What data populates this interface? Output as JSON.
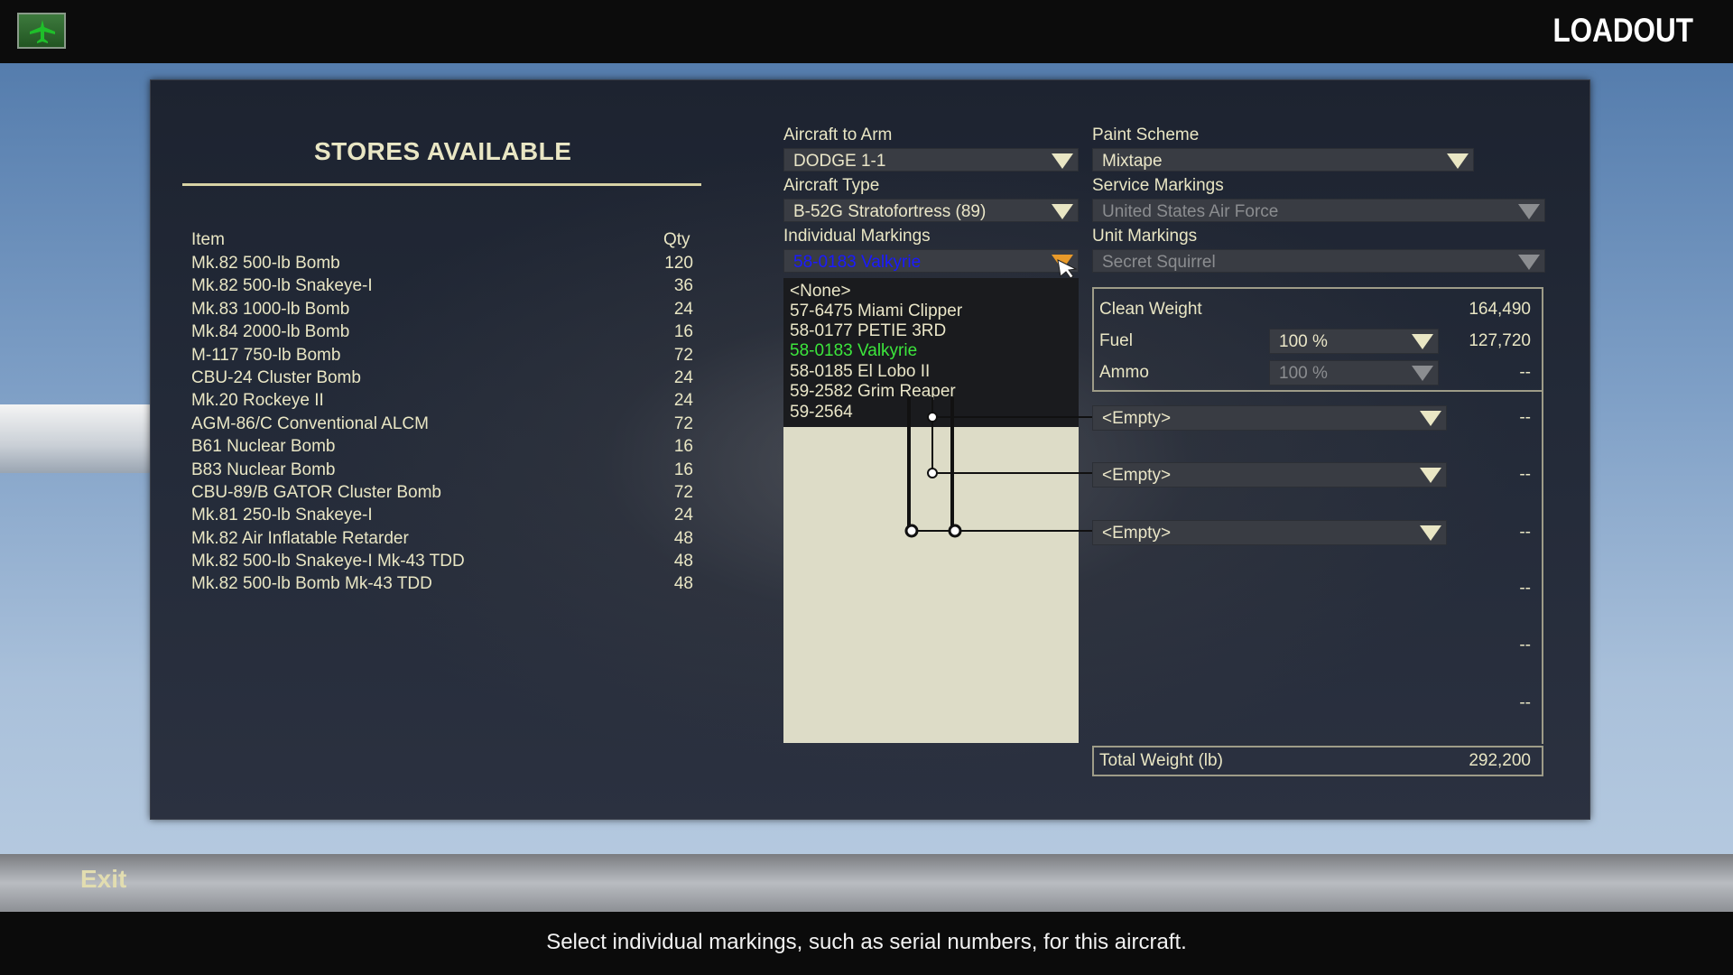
{
  "header": {
    "title": "LOADOUT"
  },
  "stores": {
    "title": "STORES AVAILABLE",
    "col_item": "Item",
    "col_qty": "Qty",
    "items": [
      {
        "name": "Mk.82 500-lb Bomb",
        "qty": "120"
      },
      {
        "name": "Mk.82 500-lb Snakeye-I",
        "qty": "36"
      },
      {
        "name": "Mk.83 1000-lb Bomb",
        "qty": "24"
      },
      {
        "name": "Mk.84 2000-lb Bomb",
        "qty": "16"
      },
      {
        "name": "M-117 750-lb Bomb",
        "qty": "72"
      },
      {
        "name": "CBU-24 Cluster Bomb",
        "qty": "24"
      },
      {
        "name": "Mk.20 Rockeye II",
        "qty": "24"
      },
      {
        "name": "AGM-86/C Conventional ALCM",
        "qty": "72"
      },
      {
        "name": "B61 Nuclear Bomb",
        "qty": "16"
      },
      {
        "name": "B83 Nuclear Bomb",
        "qty": "16"
      },
      {
        "name": "CBU-89/B GATOR Cluster Bomb",
        "qty": "72"
      },
      {
        "name": "Mk.81 250-lb Snakeye-I",
        "qty": "24"
      },
      {
        "name": "Mk.82 Air Inflatable Retarder",
        "qty": "48"
      },
      {
        "name": "Mk.82 500-lb Snakeye-I Mk-43 TDD",
        "qty": "48"
      },
      {
        "name": "Mk.82 500-lb Bomb Mk-43 TDD",
        "qty": "48"
      }
    ]
  },
  "config": {
    "aircraft_to_arm": {
      "label": "Aircraft to Arm",
      "value": "DODGE 1-1"
    },
    "aircraft_type": {
      "label": "Aircraft Type",
      "value": "B-52G Stratofortress (89)"
    },
    "individual_markings": {
      "label": "Individual Markings",
      "value": "58-0183 Valkyrie",
      "options": [
        "<None>",
        "57-6475 Miami Clipper",
        "58-0177 PETIE 3RD",
        "58-0183 Valkyrie",
        "58-0185 El Lobo II",
        "59-2582 Grim Reaper",
        "59-2564"
      ]
    },
    "paint_scheme": {
      "label": "Paint Scheme",
      "value": "Mixtape"
    },
    "service_markings": {
      "label": "Service Markings",
      "value": "United States Air Force"
    },
    "unit_markings": {
      "label": "Unit Markings",
      "value": "Secret Squirrel"
    }
  },
  "weights": {
    "clean_weight": {
      "label": "Clean Weight",
      "value": "164,490"
    },
    "fuel": {
      "label": "Fuel",
      "select": "100 %",
      "value": "127,720"
    },
    "ammo": {
      "label": "Ammo",
      "select": "100 %",
      "value": "--"
    },
    "stations": [
      {
        "select": "<Empty>",
        "value": "--"
      },
      {
        "select": "<Empty>",
        "value": "--"
      },
      {
        "select": "<Empty>",
        "value": "--"
      },
      {
        "value": "--"
      },
      {
        "value": "--"
      },
      {
        "value": "--"
      }
    ],
    "total": {
      "label": "Total Weight (lb)",
      "value": "292,200"
    }
  },
  "footer": {
    "exit_label": "Exit",
    "status": "Select individual markings, such as serial numbers, for this aircraft."
  },
  "colors": {
    "accent": "#e9e6c4",
    "selected_option": "#3ce63c",
    "bound_value": "#1a1aff"
  }
}
